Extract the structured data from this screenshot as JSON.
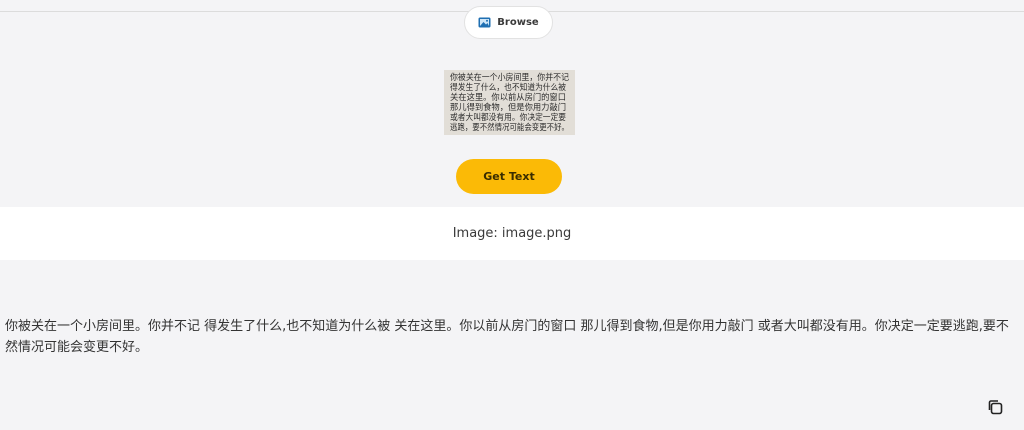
{
  "upload": {
    "browse_label": "Browse",
    "browse_icon": "image-icon"
  },
  "preview": {
    "lines": [
      "你被关在一个小房间里，你并不记",
      "得发生了什么，也不知道为什么被",
      "关在这里。你以前从房门的窗口",
      "那儿得到食物，但是你用力敲门",
      "或者大叫都没有用。你决定一定要",
      "逃跑，要不然情况可能会变更不好。"
    ]
  },
  "actions": {
    "get_text_label": "Get Text",
    "accent_color": "#fbba06"
  },
  "file": {
    "label": "Image: image.png"
  },
  "result": {
    "text": "你被关在一个小房间里。你并不记 得发生了什么,也不知道为什么被 关在这里。你以前从房门的窗口 那儿得到食物,但是你用力敲门 或者大叫都没有用。你决定一定要逃跑,要不然情况可能会变更不好。",
    "copy_icon": "copy-icon"
  }
}
